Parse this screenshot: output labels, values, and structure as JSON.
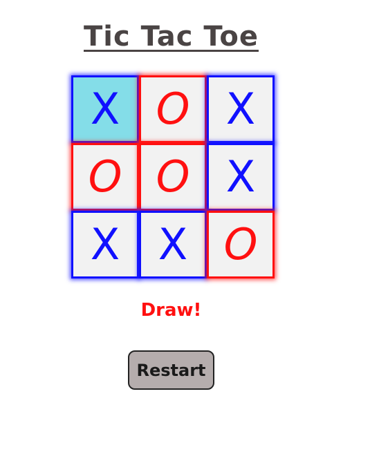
{
  "title": "Tic Tac Toe",
  "board": {
    "cells": [
      {
        "mark": "X",
        "player": "x",
        "highlight": true
      },
      {
        "mark": "O",
        "player": "o",
        "highlight": false
      },
      {
        "mark": "X",
        "player": "x",
        "highlight": false
      },
      {
        "mark": "O",
        "player": "o",
        "highlight": false
      },
      {
        "mark": "O",
        "player": "o",
        "highlight": false
      },
      {
        "mark": "X",
        "player": "x",
        "highlight": false
      },
      {
        "mark": "X",
        "player": "x",
        "highlight": false
      },
      {
        "mark": "X",
        "player": "x",
        "highlight": false
      },
      {
        "mark": "O",
        "player": "o",
        "highlight": false
      }
    ]
  },
  "status": "Draw!",
  "restart_label": "Restart",
  "colors": {
    "x": "#1010ff",
    "o": "#ff1010",
    "highlight": "#84dde8",
    "title": "#4a4444",
    "button_bg": "#b5adad"
  }
}
